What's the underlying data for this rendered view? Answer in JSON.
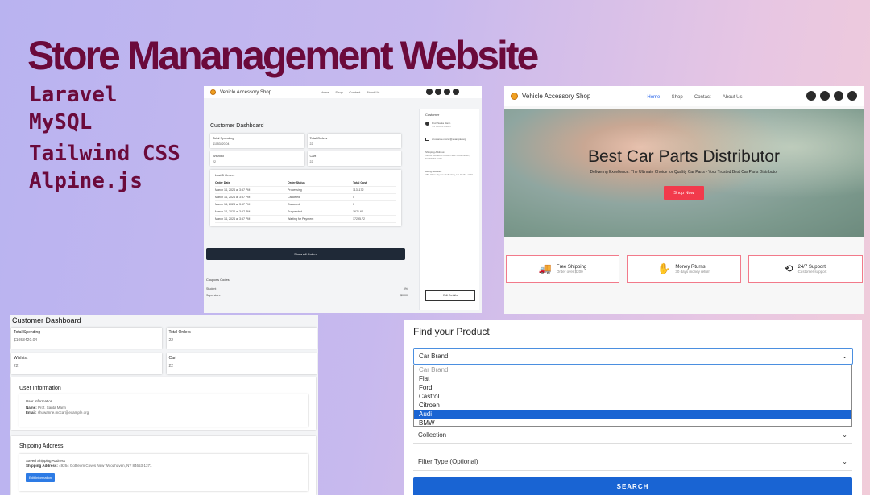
{
  "title": "Store Mananagement Website",
  "tech_stack": [
    "Laravel",
    "MySQL",
    "Tailwind CSS",
    "Alpine.js"
  ],
  "colors": {
    "title": "#6b0a3b",
    "accent_blue": "#1964d3",
    "shop_red": "#f23a4c",
    "dark_button": "#1f2937"
  },
  "shop_brand": "Vehicle Accessory Shop",
  "nav_links": [
    "Home",
    "Shop",
    "Contact",
    "About Us"
  ],
  "nav_icons": [
    "heart-icon",
    "cart-icon",
    "users-icon",
    "user-icon"
  ],
  "dashboard_small": {
    "title": "Customer Dashboard",
    "stats": [
      {
        "label": "Total Spending",
        "value": "$1053420.04"
      },
      {
        "label": "Total Orders",
        "value": "22"
      },
      {
        "label": "Wishlist",
        "value": "22"
      },
      {
        "label": "Cart",
        "value": "22"
      }
    ],
    "orders_title": "Last 5 Orders",
    "orders_headers": [
      "Order Date",
      "Order Status",
      "Total Cost"
    ],
    "orders": [
      [
        "March 14, 2024 at 3:57 PM",
        "Processing",
        "1131172"
      ],
      [
        "March 14, 2024 at 3:57 PM",
        "Canceled",
        "0"
      ],
      [
        "March 14, 2024 at 3:57 PM",
        "Canceled",
        "0"
      ],
      [
        "March 14, 2024 at 3:57 PM",
        "Suspended",
        "1671.64"
      ],
      [
        "March 14, 2024 at 3:57 PM",
        "Waiting for Payment",
        "17295.72"
      ]
    ],
    "show_all": "Show All Orders",
    "coupons_title": "Coupons Codes",
    "coupons": [
      [
        "Student",
        "5%"
      ],
      [
        "Superstore",
        "$0.00"
      ]
    ],
    "side_customer": "Customer",
    "side_name": "Prof. Santa Mann",
    "side_role": "TN Movies Dalton",
    "side_email": "shuwanne.mccar@example.org",
    "side_shipping_label": "Shipping Address:",
    "side_shipping": "49264 Gottleom Coves New Woodhaven, NY 84653-1371",
    "side_billing_label": "Billing Address:",
    "side_billing": "789 Office Syntax Jefferkirg, VA 93464-1739",
    "side_edit": "Edit Details"
  },
  "hero": {
    "heading": "Best Car Parts Distributor",
    "subtitle": "Delivering Excellence: The Ultimate Choice for Quality Car Parts - Your Trusted Best Car Parts Distributor",
    "cta": "Shop Now"
  },
  "features": [
    {
      "icon": "truck-icon",
      "title": "Free Shipping",
      "sub": "Order over $200"
    },
    {
      "icon": "money-hand-icon",
      "title": "Money Rturns",
      "sub": "30 days money return"
    },
    {
      "icon": "support-clock-icon",
      "title": "24/7 Support",
      "sub": "Customer support"
    }
  ],
  "dashboard_large": {
    "title": "Customer Dashboard",
    "stats": [
      {
        "label": "Total Spending",
        "value": "$1053420.04"
      },
      {
        "label": "Total Orders",
        "value": "22"
      },
      {
        "label": "Wishlist",
        "value": "22"
      },
      {
        "label": "Cart",
        "value": "22"
      }
    ],
    "user_section": "User Information",
    "user_card_title": "User Information",
    "name_label": "Name:",
    "name_value": "Prof. Santa Mann",
    "email_label": "Email:",
    "email_value": "shuwanne.mccar@example.org",
    "shipping_section": "Shipping Address",
    "shipping_card_title": "Saved Shipping Address",
    "shipping_label": "Shipping Address:",
    "shipping_value": "49264 Gottleom Coves New Woodhaven, NY 84653-1371",
    "edit_button": "Edit Information"
  },
  "finder": {
    "title": "Find your Product",
    "select_value": "Car Brand",
    "options": [
      "Car Brand",
      "Fiat",
      "Ford",
      "Castrol",
      "Citroen",
      "Audi",
      "BMW"
    ],
    "selected_option": "Audi",
    "collection": "Collection",
    "filter_type": "Filter Type (Optional)",
    "search": "SEARCH"
  }
}
